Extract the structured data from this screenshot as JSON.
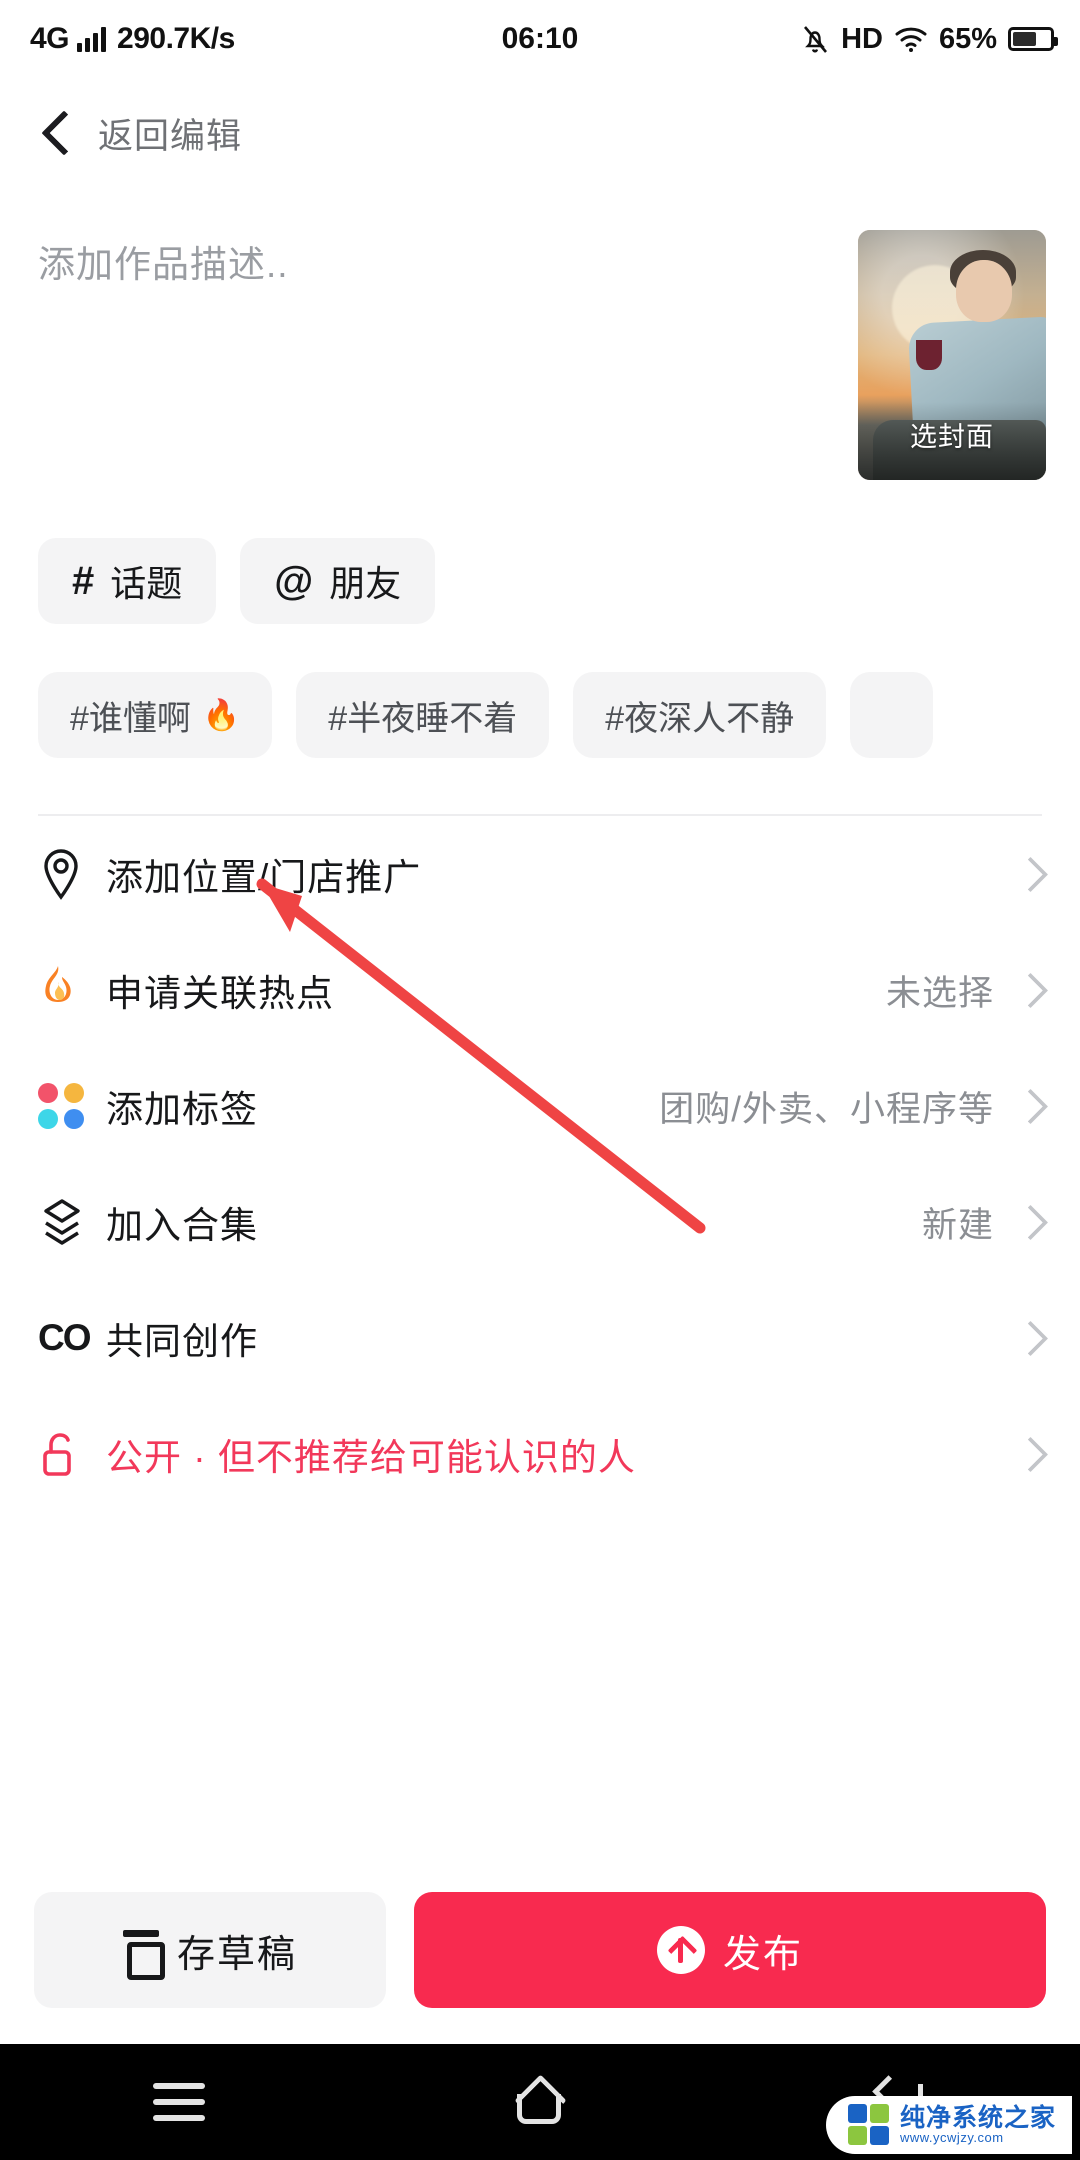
{
  "statusbar": {
    "network": "4G",
    "speed": "290.7K/s",
    "time": "06:10",
    "hd": "HD",
    "battery_pct": "65%",
    "icons": [
      "signal-bars-icon",
      "mute-bell-icon",
      "hd-icon",
      "wifi-icon",
      "battery-icon"
    ]
  },
  "navbar": {
    "back_label": "返回编辑"
  },
  "description": {
    "placeholder": "添加作品描述..",
    "value": ""
  },
  "cover": {
    "label": "选封面"
  },
  "chips": [
    {
      "symbol": "#",
      "label": "话题"
    },
    {
      "symbol": "@",
      "label": "朋友"
    }
  ],
  "suggestions": [
    {
      "label": "#谁懂啊",
      "fire": "🔥"
    },
    {
      "label": "#半夜睡不着",
      "fire": ""
    },
    {
      "label": "#夜深人不静",
      "fire": ""
    }
  ],
  "menu": [
    {
      "icon": "location-pin-icon",
      "label": "添加位置/门店推广",
      "value": ""
    },
    {
      "icon": "flame-icon",
      "label": "申请关联热点",
      "value": "未选择"
    },
    {
      "icon": "color-dots-icon",
      "label": "添加标签",
      "value": "团购/外卖、小程序等"
    },
    {
      "icon": "layers-icon",
      "label": "加入合集",
      "value": "新建"
    },
    {
      "icon": "co-create-icon",
      "label": "共同创作",
      "value": ""
    },
    {
      "icon": "unlock-icon",
      "label": "公开 · 但不推荐给可能认识的人",
      "value": ""
    }
  ],
  "actions": {
    "draft_label": "存草稿",
    "publish_label": "发布",
    "draft_icon": "save-draft-icon",
    "publish_icon": "upload-arrow-icon"
  },
  "sysnav": {
    "items": [
      "menu-icon",
      "home-icon",
      "back-icon"
    ]
  },
  "watermark": {
    "name": "纯净系统之家",
    "url": "www.ycwjzy.com"
  },
  "colors": {
    "accent_red": "#f82a4f",
    "privacy_pink": "#f2385a",
    "chip_bg": "#f4f4f5",
    "muted_text": "#8b8e93"
  }
}
